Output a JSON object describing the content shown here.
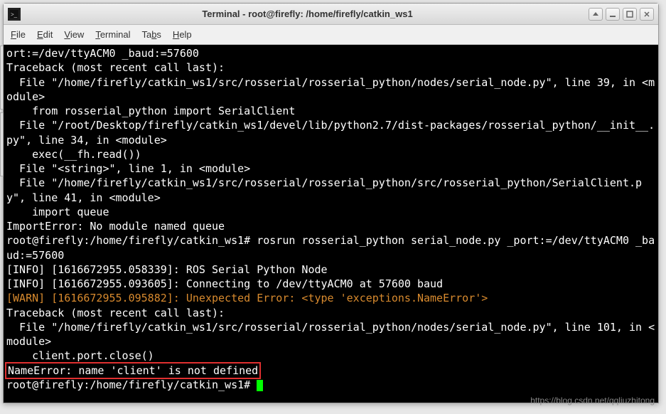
{
  "window": {
    "title": "Terminal - root@firefly: /home/firefly/catkin_ws1"
  },
  "menubar": {
    "file": "File",
    "edit": "Edit",
    "view": "View",
    "terminal": "Terminal",
    "tabs": "Tabs",
    "help": "Help"
  },
  "terminal_lines": [
    {
      "text": "ort:=/dev/ttyACM0 _baud:=57600",
      "class": ""
    },
    {
      "text": "Traceback (most recent call last):",
      "class": ""
    },
    {
      "text": "  File \"/home/firefly/catkin_ws1/src/rosserial/rosserial_python/nodes/serial_node.py\", line 39, in <module>",
      "class": ""
    },
    {
      "text": "    from rosserial_python import SerialClient",
      "class": ""
    },
    {
      "text": "  File \"/root/Desktop/firefly/catkin_ws1/devel/lib/python2.7/dist-packages/rosserial_python/__init__.py\", line 34, in <module>",
      "class": ""
    },
    {
      "text": "    exec(__fh.read())",
      "class": ""
    },
    {
      "text": "  File \"<string>\", line 1, in <module>",
      "class": ""
    },
    {
      "text": "  File \"/home/firefly/catkin_ws1/src/rosserial/rosserial_python/src/rosserial_python/SerialClient.py\", line 41, in <module>",
      "class": ""
    },
    {
      "text": "    import queue",
      "class": ""
    },
    {
      "text": "ImportError: No module named queue",
      "class": ""
    },
    {
      "text": "root@firefly:/home/firefly/catkin_ws1# rosrun rosserial_python serial_node.py _port:=/dev/ttyACM0 _baud:=57600",
      "class": ""
    },
    {
      "text": "[INFO] [1616672955.058339]: ROS Serial Python Node",
      "class": ""
    },
    {
      "text": "[INFO] [1616672955.093605]: Connecting to /dev/ttyACM0 at 57600 baud",
      "class": ""
    },
    {
      "text": "[WARN] [1616672955.095882]: Unexpected Error: <type 'exceptions.NameError'>",
      "class": "warn"
    },
    {
      "text": "Traceback (most recent call last):",
      "class": ""
    },
    {
      "text": "  File \"/home/firefly/catkin_ws1/src/rosserial/rosserial_python/nodes/serial_node.py\", line 101, in <module>",
      "class": ""
    },
    {
      "text": "    client.port.close()",
      "class": ""
    }
  ],
  "highlighted_error": "NameError: name 'client' is not defined",
  "prompt": "root@firefly:/home/firefly/catkin_ws1# ",
  "watermark": "https://blog.csdn.net/qqliuzhitong"
}
